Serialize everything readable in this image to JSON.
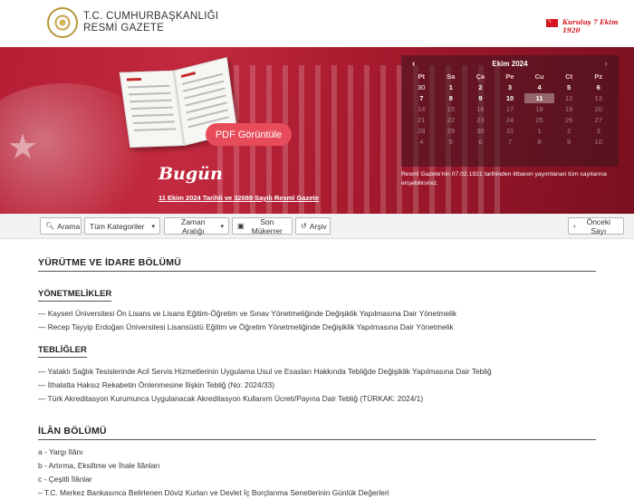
{
  "header": {
    "brand_line1": "T.C. CUMHURBAŞKANLIĞI",
    "brand_line2": "RESMİ GAZETE",
    "founded": "Kuruluş 7 Ekim 1920"
  },
  "banner": {
    "pdf_button": "PDF Görüntüle",
    "today_label": "Bugün",
    "today_link": "11 Ekim 2024 Tarihli ve 32689 Sayılı Resmî Gazete",
    "calendar_note": "Resmî Gazete'nin 07.02.1921 tarihinden itibaren yayımlanan tüm sayılarına erişebilirsiniz."
  },
  "calendar": {
    "month": "Ekim 2024",
    "prev": "‹",
    "next": "›",
    "weekdays": [
      "Pt",
      "Sa",
      "Ça",
      "Pe",
      "Cu",
      "Ct",
      "Pz"
    ],
    "rows": [
      [
        "30",
        "1",
        "2",
        "3",
        "4",
        "5",
        "6"
      ],
      [
        "7",
        "8",
        "9",
        "10",
        "11",
        "12",
        "13"
      ],
      [
        "14",
        "15",
        "16",
        "17",
        "18",
        "19",
        "20"
      ],
      [
        "21",
        "22",
        "23",
        "24",
        "25",
        "26",
        "27"
      ],
      [
        "28",
        "29",
        "30",
        "31",
        "1",
        "2",
        "3"
      ],
      [
        "4",
        "5",
        "6",
        "7",
        "8",
        "9",
        "10"
      ]
    ]
  },
  "toolbar": {
    "search": "Arama",
    "categories": "Tüm Kategoriler",
    "range": "Zaman Aralığı",
    "repeats": "Son Mükerrer",
    "archive": "Arşiv",
    "prev_issue": "Önceki Sayı"
  },
  "content": {
    "section1_title": "YÜRÜTME VE İDARE BÖLÜMÜ",
    "regulations_title": "YÖNETMELİKLER",
    "regulations": [
      "— Kayseri Üniversitesi Ön Lisans ve Lisans Eğitim-Öğretim ve Sınav Yönetmeliğinde Değişiklik Yapılmasına Dair Yönetmelik",
      "— Recep Tayyip Erdoğan Üniversitesi Lisansüstü Eğitim ve Öğretim Yönetmeliğinde Değişiklik Yapılmasına Dair Yönetmelik"
    ],
    "communiques_title": "TEBLİĞLER",
    "communiques": [
      "— Yataklı Sağlık Tesislerinde Acil Servis Hizmetlerinin Uygulama Usul ve Esasları Hakkında Tebliğde Değişiklik Yapılmasına Dair Tebliğ",
      "— İthalatta Haksız Rekabetin Önlenmesine İlişkin Tebliğ (No: 2024/33)",
      "— Türk Akreditasyon Kurumunca Uygulanacak Akreditasyon Kullanım Ücreti/Payına Dair Tebliğ (TÜRKAK: 2024/1)"
    ],
    "section2_title": "İLÂN BÖLÜMÜ",
    "announcements": [
      "a - Yargı İlânı",
      "b - Artırma, Eksiltme ve İhale İlânları",
      "c - Çeşitli İlânlar",
      "– T.C. Merkez Bankasınca Belirlenen Döviz Kurları ve Devlet İç Borçlanma Senetlerinin Günlük Değerleri"
    ]
  }
}
